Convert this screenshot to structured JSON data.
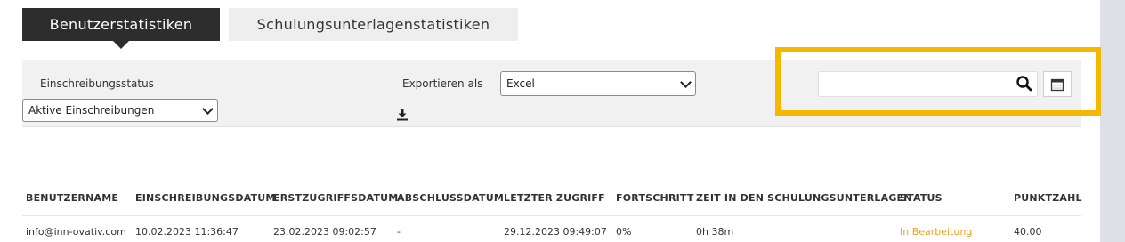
{
  "tabs": [
    {
      "label": "Benutzerstatistiken"
    },
    {
      "label": "Schulungsunterlagenstatistiken"
    }
  ],
  "filters": {
    "enrollment_status_label": "Einschreibungsstatus",
    "enrollment_status_value": "Aktive Einschreibungen",
    "export_label": "Exportieren als",
    "export_value": "Excel",
    "search_value": ""
  },
  "icons": {
    "download": "download-icon",
    "search": "search-icon",
    "calendar": "calendar-icon"
  },
  "colors": {
    "active_tab_bg": "#2d2d2d",
    "highlight": "#f5b800",
    "status_in_progress": "#f0a31f"
  },
  "table": {
    "columns": [
      "BENUTZERNAME",
      "EINSCHREIBUNGSDATUM",
      "ERSTZUGRIFFSDATUM",
      "ABSCHLUSSDATUM",
      "LETZTER ZUGRIFF",
      "FORTSCHRITT",
      "ZEIT IN DEN SCHULUNGSUNTERLAGEN",
      "STATUS",
      "PUNKTZAHL"
    ],
    "rows": [
      [
        "info@inn-ovativ.com",
        "10.02.2023 11:36:47",
        "23.02.2023 09:02:57",
        "-",
        "29.12.2023 09:49:07",
        "0%",
        "0h 38m",
        "In Bearbeitung",
        "40.00"
      ]
    ]
  }
}
